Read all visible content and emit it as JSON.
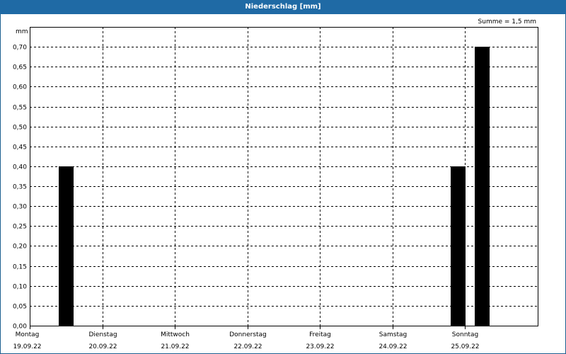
{
  "window": {
    "title": "Niederschlag [mm]"
  },
  "summary": {
    "text": "Summe = 1,5 mm"
  },
  "chart_data": {
    "type": "bar",
    "title": "Niederschlag [mm]",
    "ylabel": "mm",
    "ylim": [
      0,
      0.75
    ],
    "y_ticks": [
      "0,00",
      "0,05",
      "0,10",
      "0,15",
      "0,20",
      "0,25",
      "0,30",
      "0,35",
      "0,40",
      "0,45",
      "0,50",
      "0,55",
      "0,60",
      "0,65",
      "0,70"
    ],
    "days": [
      {
        "name": "Montag",
        "date": "19.09.22"
      },
      {
        "name": "Dienstag",
        "date": "20.09.22"
      },
      {
        "name": "Mittwoch",
        "date": "21.09.22"
      },
      {
        "name": "Donnerstag",
        "date": "22.09.22"
      },
      {
        "name": "Freitag",
        "date": "23.09.22"
      },
      {
        "name": "Samstag",
        "date": "24.09.22"
      },
      {
        "name": "Sonntag",
        "date": "25.09.22"
      }
    ],
    "bars": [
      {
        "day_position": 0.5,
        "value": 0.4
      },
      {
        "day_position": 5.9,
        "value": 0.4
      },
      {
        "day_position": 6.23,
        "value": 0.7
      }
    ],
    "bar_color": "#000000",
    "grid": true
  }
}
